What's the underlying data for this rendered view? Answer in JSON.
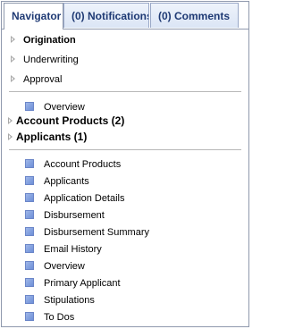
{
  "tabs": {
    "navigator": "Navigator",
    "notifications_count": "(0)",
    "notifications": "Notifications",
    "comments_count": "(0)",
    "comments": "Comments"
  },
  "stages": [
    "Origination",
    "Underwriting",
    "Approval"
  ],
  "overview_top": "Overview",
  "sections": {
    "account_products": "Account Products (2)",
    "applicants": "Applicants (1)"
  },
  "links": [
    "Account Products",
    "Applicants",
    "Application Details",
    "Disbursement",
    "Disbursement Summary",
    "Email History",
    "Overview",
    "Primary Applicant",
    "Stipulations",
    "To Dos"
  ],
  "colors": {
    "tab_text": "#1f3a74",
    "border": "#8f99ad",
    "item_square": "#7c9ae0"
  }
}
